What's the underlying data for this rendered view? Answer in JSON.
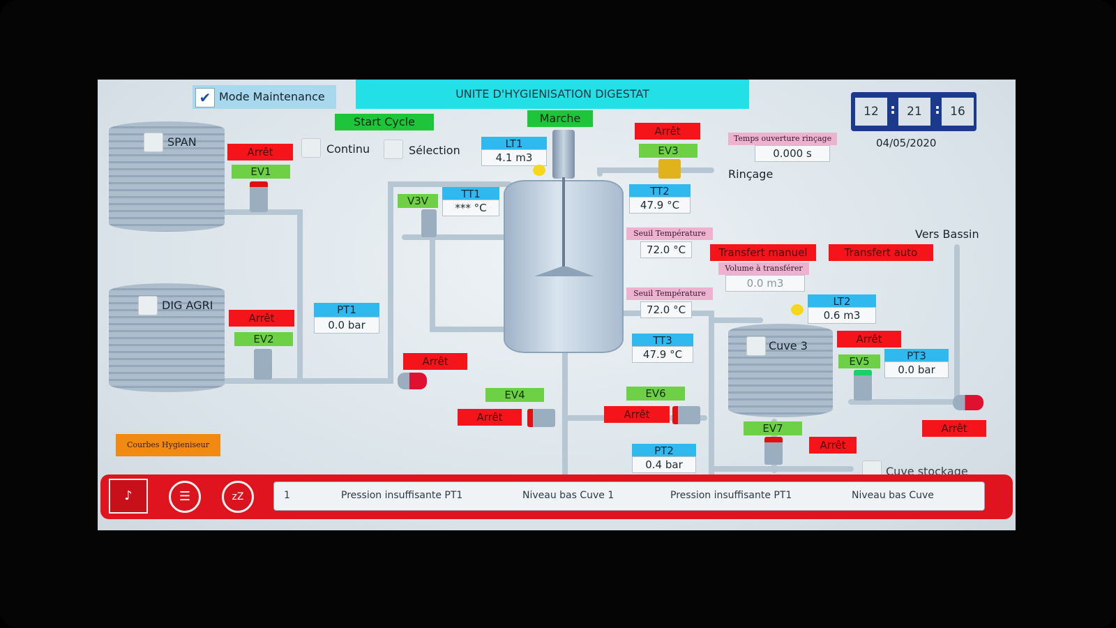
{
  "header": {
    "title": "UNITE D'HYGIENISATION DIGESTAT",
    "mode_label": "Mode Maintenance",
    "mode_checked": true
  },
  "clock": {
    "hh": "12",
    "mm": "21",
    "ss": "16",
    "date": "04/05/2020"
  },
  "buttons": {
    "start_cycle": "Start Cycle",
    "marche": "Marche",
    "transfert_manuel": "Transfert manuel",
    "transfert_auto": "Transfert auto",
    "courbes": "Courbes Hygieniseur"
  },
  "options": {
    "continu": "Continu",
    "selection": "Sélection"
  },
  "tanks": {
    "span": "SPAN",
    "dig_agri": "DIG AGRI",
    "cuve3": "Cuve 3",
    "cuve_stockage": "Cuve stockage"
  },
  "valves": {
    "ev1": {
      "name": "EV1",
      "state": "Arrêt"
    },
    "ev2": {
      "name": "EV2",
      "state": "Arrêt"
    },
    "ev3": {
      "name": "EV3",
      "state": "Arrêt"
    },
    "ev4": {
      "name": "EV4",
      "state": "Arrêt"
    },
    "ev5": {
      "name": "EV5",
      "state": "Arrêt"
    },
    "ev6": {
      "name": "EV6",
      "state": "Arrêt"
    },
    "ev7": {
      "name": "EV7",
      "state": "Arrêt"
    },
    "v3v": {
      "name": "V3V"
    },
    "pump1_state": "Arrêt",
    "pump3_state": "Arrêt"
  },
  "sensors": {
    "lt1": {
      "name": "LT1",
      "value": "4.1 m3"
    },
    "lt2": {
      "name": "LT2",
      "value": "0.6 m3"
    },
    "tt1": {
      "name": "TT1",
      "value": "*** °C"
    },
    "tt2": {
      "name": "TT2",
      "value": "47.9 °C"
    },
    "tt3": {
      "name": "TT3",
      "value": "47.9 °C"
    },
    "pt1": {
      "name": "PT1",
      "value": "0.0 bar"
    },
    "pt2": {
      "name": "PT2",
      "value": "0.4 bar"
    },
    "pt3": {
      "name": "PT3",
      "value": "0.0 bar"
    }
  },
  "params": {
    "rincage_label": "Temps ouverture rinçage",
    "rincage_value": "0.000 s",
    "seuil1_label": "Seuil Température",
    "seuil1_value": "72.0 °C",
    "seuil2_label": "Seuil Température",
    "seuil2_value": "72.0 °C",
    "volume_label": "Volume à transférer",
    "volume_value": "0.0 m3"
  },
  "labels": {
    "rincage": "Rinçage",
    "vers_bassin": "Vers Bassin"
  },
  "alarms": {
    "index": "1",
    "messages": [
      "Pression insuffisante PT1",
      "Niveau bas Cuve 1",
      "Pression insuffisante PT1",
      "Niveau bas Cuve"
    ]
  },
  "colors": {
    "alarm_red": "#f4141a",
    "valve_green": "#6ed145",
    "sensor_blue": "#2fb9ef",
    "title_cyan": "#23e0e6",
    "param_pink": "#ecb2cf"
  }
}
